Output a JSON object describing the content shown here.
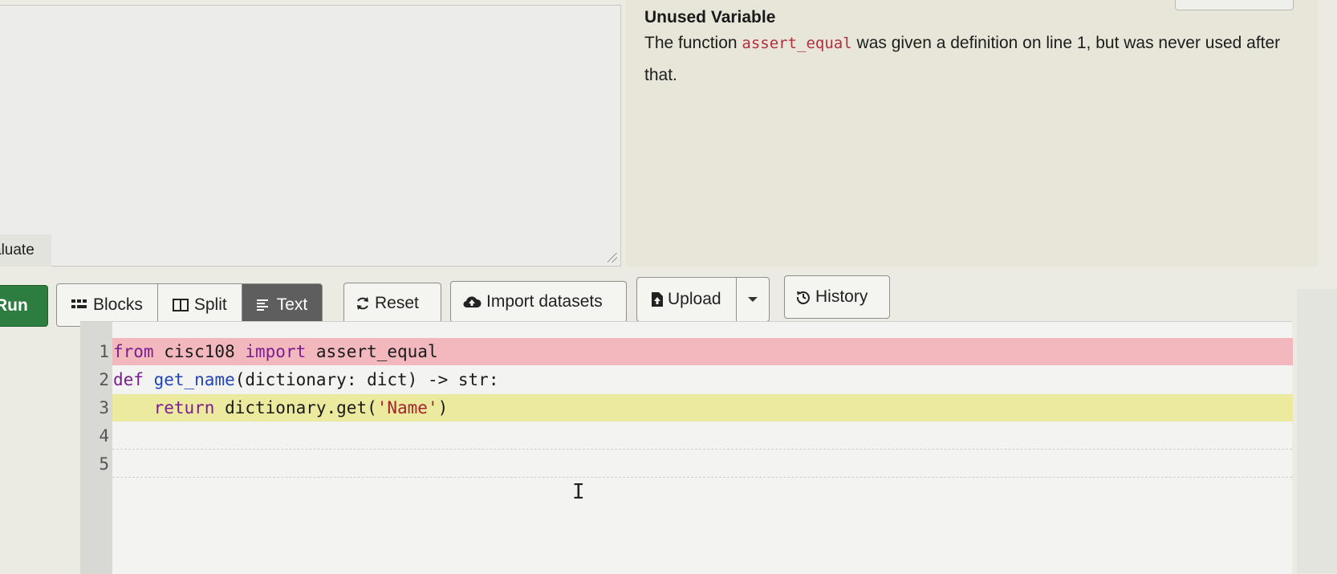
{
  "console": {
    "evaluate_label": "aluate"
  },
  "feedback": {
    "title": "Unused Variable",
    "message_before": "The function ",
    "message_code": "assert_equal",
    "message_after": " was given a definition on line 1, but was never used after that."
  },
  "toolbar": {
    "run_label": "Run",
    "blocks_label": "Blocks",
    "split_label": "Split",
    "text_label": "Text",
    "reset_label": "Reset",
    "import_label": "Import datasets",
    "upload_label": "Upload",
    "history_label": "History"
  },
  "editor": {
    "lines": [
      {
        "num": "1",
        "status": "error",
        "code": "from cisc108 import assert_equal"
      },
      {
        "num": "2",
        "status": "normal",
        "code": "def get_name(dictionary: dict) -> str:"
      },
      {
        "num": "3",
        "status": "warning",
        "code": "    return dictionary.get('Name')"
      },
      {
        "num": "4",
        "status": "normal",
        "code": ""
      },
      {
        "num": "5",
        "status": "normal",
        "code": ""
      }
    ]
  },
  "colors": {
    "run_button": "#2e7d40",
    "error_line": "#f2b8be",
    "warning_line": "#ecea9f",
    "active_tab": "#5e5e5e",
    "code_highlight": "#b0303e"
  },
  "icons": [
    "blocks-icon",
    "split-icon",
    "text-icon",
    "reset-icon",
    "cloud-upload-icon",
    "file-upload-icon",
    "caret-down-icon",
    "history-icon",
    "text-cursor-icon"
  ]
}
